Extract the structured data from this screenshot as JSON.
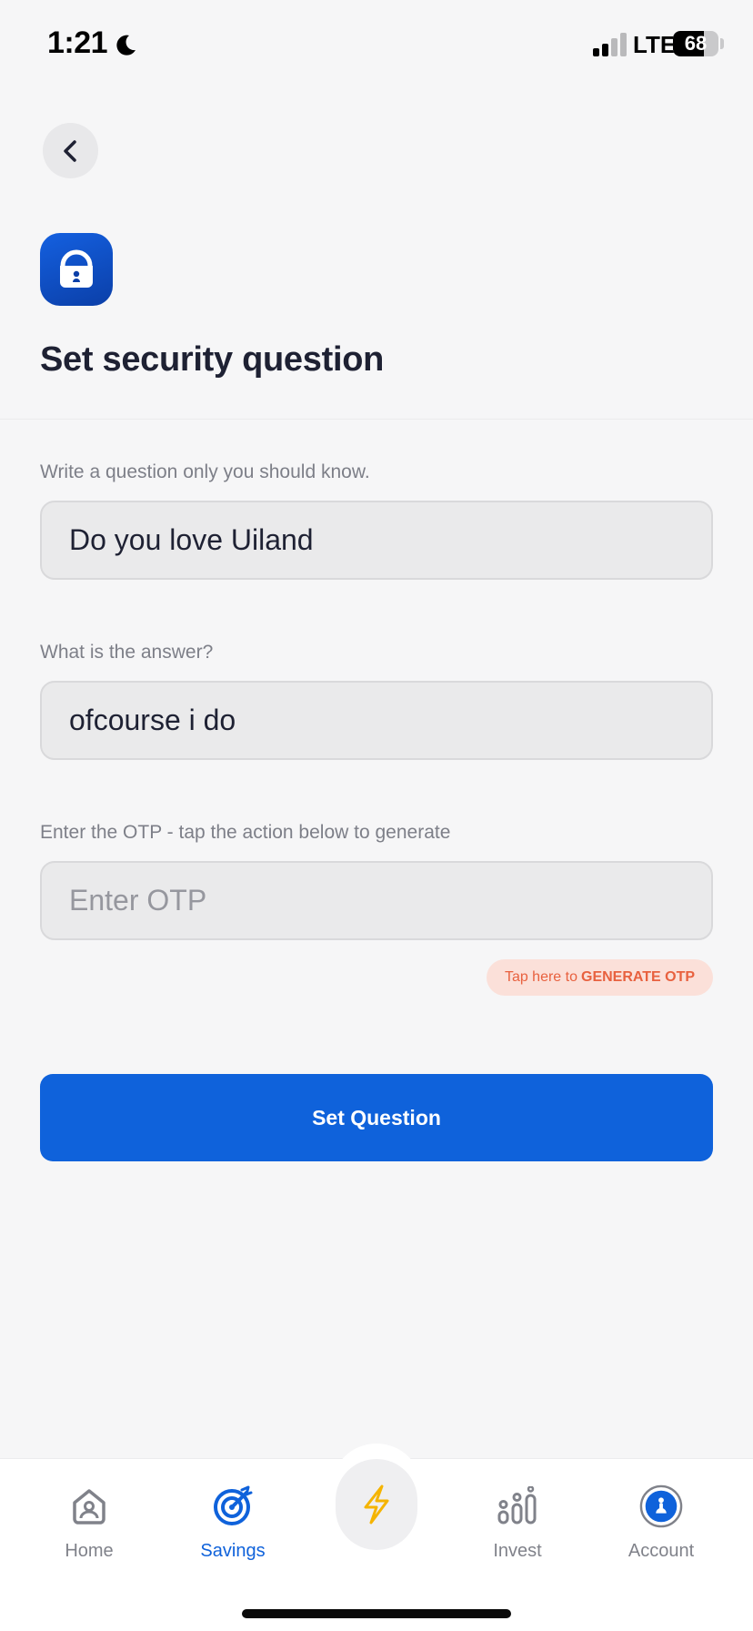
{
  "status_bar": {
    "time": "1:21",
    "network": "LTE",
    "battery_level": "68",
    "battery_fraction": 0.68
  },
  "header": {
    "back_icon": "chevron-left-icon",
    "badge_icon": "lock-icon",
    "title": "Set security question"
  },
  "form": {
    "question": {
      "label": "Write a question only you should know.",
      "value": "Do you love Uiland"
    },
    "answer": {
      "label": "What is the answer?",
      "value": "ofcourse i do"
    },
    "otp": {
      "label": "Enter the OTP - tap the action below to generate",
      "value": "",
      "placeholder": "Enter OTP"
    },
    "generate_otp": {
      "prefix": "Tap here to",
      "action": "GENERATE OTP"
    },
    "submit_label": "Set Question"
  },
  "bottom_nav": {
    "items": [
      {
        "label": "Home",
        "icon": "home-icon",
        "active": false
      },
      {
        "label": "Savings",
        "icon": "target-icon",
        "active": true
      },
      {
        "label": "Invest",
        "icon": "bar-chart-icon",
        "active": false
      },
      {
        "label": "Account",
        "icon": "account-icon",
        "active": false
      }
    ],
    "center_icon": "lightning-icon"
  },
  "colors": {
    "primary": "#0f62db",
    "otp_action": "#e8613f",
    "otp_action_bg": "#fbe0d9",
    "lightning": "#f5b400"
  }
}
